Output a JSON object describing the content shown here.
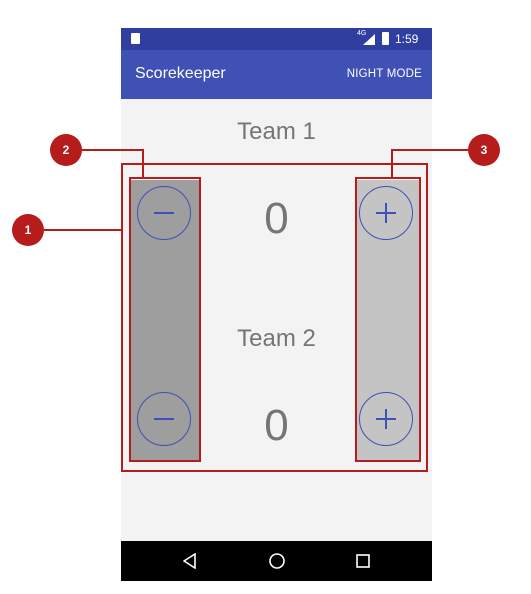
{
  "status_bar": {
    "time": "1:59",
    "network": "4G"
  },
  "app_bar": {
    "title": "Scorekeeper",
    "action": "NIGHT MODE"
  },
  "team1": {
    "name": "Team 1",
    "score": "0"
  },
  "team2": {
    "name": "Team 2",
    "score": "0"
  },
  "annotations": [
    "1",
    "2",
    "3"
  ],
  "colors": {
    "primary": "#3f51b5",
    "primary_dark": "#303f9f",
    "annotation": "#b71c1c",
    "decrease_column": "#9e9e9e",
    "increase_column": "#c4c4c4"
  },
  "icons": {
    "minus": "minus-icon",
    "plus": "plus-icon",
    "back": "back-triangle-icon",
    "home": "home-circle-icon",
    "recents": "recents-square-icon"
  }
}
